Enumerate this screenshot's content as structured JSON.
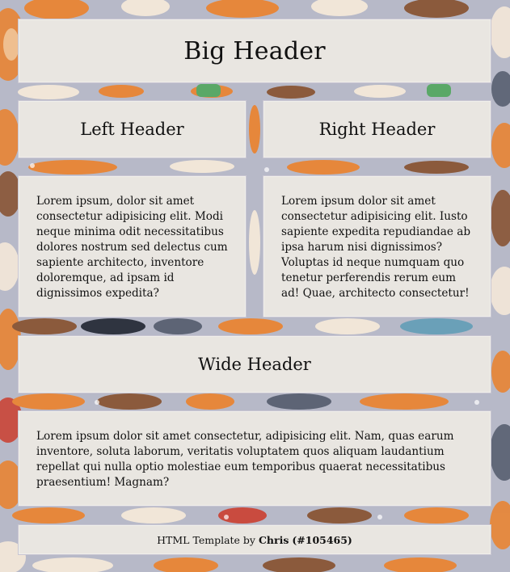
{
  "big_header": {
    "title": "Big Header"
  },
  "left_header": {
    "title": "Left Header"
  },
  "right_header": {
    "title": "Right Header"
  },
  "left_panel": {
    "text": "Lorem ipsum, dolor sit amet consectetur adipisicing elit. Modi neque minima odit necessitatibus dolores nostrum sed delectus cum sapiente architecto, inventore doloremque, ad ipsam id dignissimos expedita?"
  },
  "right_panel": {
    "text": "Lorem ipsum dolor sit amet consectetur adipisicing elit. Iusto sapiente expedita repudiandae ab ipsa harum nisi dignissimos? Voluptas id neque numquam quo tenetur perferendis rerum eum ad! Quae, architecto consectetur!"
  },
  "wide_header": {
    "title": "Wide Header"
  },
  "wide_panel": {
    "text": "Lorem ipsum dolor sit amet consectetur, adipisicing elit. Nam, quas earum inventore, soluta laborum, veritatis voluptatem quos aliquam laudantium repellat qui nulla optio molestiae eum temporibus quaerat necessitatibus praesentium! Magnam?"
  },
  "footer": {
    "prefix": "HTML Template by ",
    "author": "Chris",
    "id": "(#105465)"
  },
  "colors": {
    "panel_bg": "#e9e6e1",
    "panel_border": "#c9c6d2",
    "pattern_bg": "#b7b9c8",
    "cat_orange": "#e6873b",
    "cat_brown": "#8b5a3c",
    "cat_grey": "#5d6475",
    "cat_dark": "#2f3440",
    "accent_red": "#c94b3f",
    "accent_green": "#5aa867",
    "accent_teal": "#6aa0b8"
  },
  "icons": {
    "background": "cat-pattern-background"
  }
}
